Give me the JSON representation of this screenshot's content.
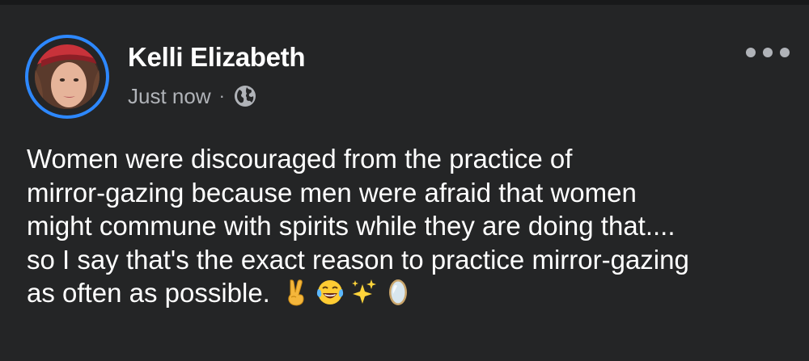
{
  "post": {
    "author_name": "Kelli Elizabeth",
    "timestamp": "Just now",
    "separator": "·",
    "privacy_icon": "globe-icon",
    "more_icon": "more-horizontal-icon",
    "text_lines": [
      "Women were discouraged from the practice of",
      "mirror-gazing because men were afraid that women",
      "might commune with spirits while they are doing that....",
      "so I say that's the exact reason to practice mirror-gazing",
      "as often as possible."
    ],
    "emojis": [
      "victory-hand-emoji",
      "tears-of-joy-emoji",
      "sparkles-emoji",
      "mirror-emoji"
    ]
  },
  "colors": {
    "background": "#242526",
    "avatar_ring": "#2d88ff",
    "name_text": "#ffffff",
    "meta_text": "#b0b3b8"
  }
}
